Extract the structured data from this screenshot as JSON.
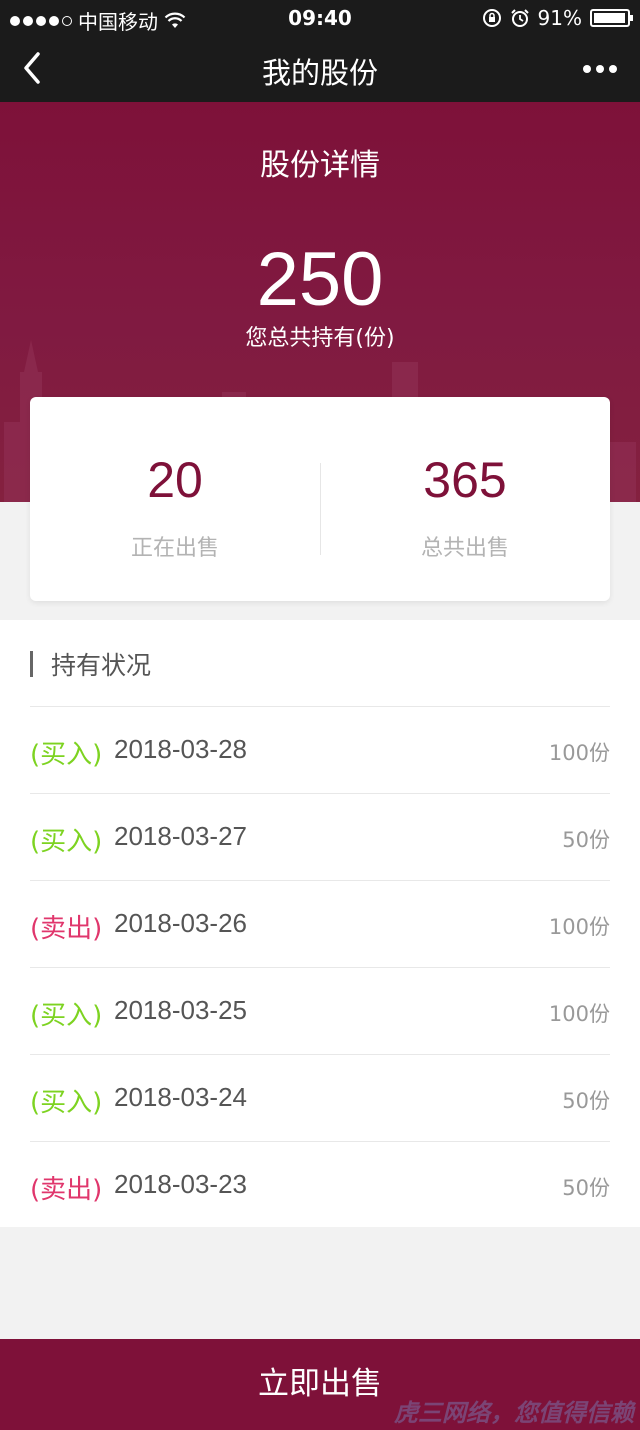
{
  "status_bar": {
    "carrier": "中国移动",
    "time": "09:40",
    "battery": "91%",
    "battery_level": 0.91
  },
  "nav": {
    "title": "我的股份",
    "back_icon": "chevron-left-icon",
    "more_icon": "more-dots-icon"
  },
  "hero": {
    "title": "股份详情",
    "total": "250",
    "total_label": "您总共持有(份)"
  },
  "stats": {
    "on_sale": {
      "value": "20",
      "label": "正在出售"
    },
    "total_sold": {
      "value": "365",
      "label": "总共出售"
    }
  },
  "holdings": {
    "title": "持有状况",
    "rows": [
      {
        "type": "(买入)",
        "kind": "buy",
        "date": "2018-03-28",
        "qty": "100份"
      },
      {
        "type": "(买入)",
        "kind": "buy",
        "date": "2018-03-27",
        "qty": "50份"
      },
      {
        "type": "(卖出)",
        "kind": "sell",
        "date": "2018-03-26",
        "qty": "100份"
      },
      {
        "type": "(买入)",
        "kind": "buy",
        "date": "2018-03-25",
        "qty": "100份"
      },
      {
        "type": "(买入)",
        "kind": "buy",
        "date": "2018-03-24",
        "qty": "50份"
      },
      {
        "type": "(卖出)",
        "kind": "sell",
        "date": "2018-03-23",
        "qty": "50份"
      }
    ]
  },
  "actions": {
    "sell_now": "立即出售"
  },
  "watermark": "虎三网络，您值得信赖",
  "colors": {
    "brand": "#7e1139",
    "buy": "#7dd321",
    "sell": "#e0366c"
  }
}
